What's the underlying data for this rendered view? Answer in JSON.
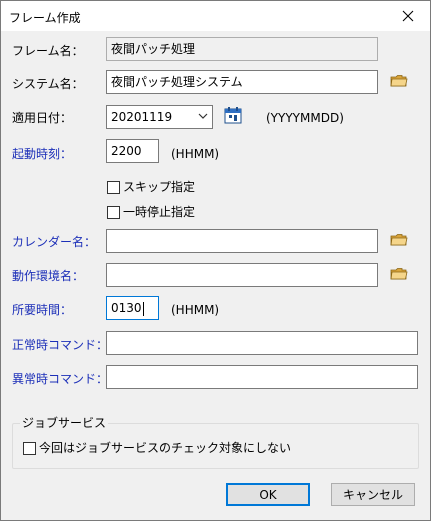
{
  "window": {
    "title": "フレーム作成"
  },
  "form": {
    "frame_name_label": "フレーム名：",
    "frame_name_value": "夜間パッチ処理",
    "system_name_label": "システム名：",
    "system_name_value": "夜間パッチ処理システム",
    "apply_date_label": "適用日付：",
    "apply_date_value": "20201119",
    "apply_date_hint": "(YYYYMMDD)",
    "start_time_label": "起動時刻：",
    "start_time_value": "2200",
    "start_time_hint": "(HHMM)",
    "skip_label": "スキップ指定",
    "pause_label": "一時停止指定",
    "calendar_label": "カレンダー名：",
    "calendar_value": "",
    "env_label": "動作環境名：",
    "env_value": "",
    "required_time_label": "所要時間：",
    "required_time_value": "0130",
    "required_time_hint": "(HHMM)",
    "normal_cmd_label": "正常時コマンド：",
    "normal_cmd_value": "",
    "abnormal_cmd_label": "異常時コマンド：",
    "abnormal_cmd_value": ""
  },
  "job_service": {
    "group_title": "ジョブサービス",
    "exclude_label": "今回はジョブサービスのチェック対象にしない"
  },
  "buttons": {
    "ok": "OK",
    "cancel": "キャンセル"
  },
  "colors": {
    "accent_label": "#1c2fb8",
    "focus_border": "#0078d7"
  }
}
